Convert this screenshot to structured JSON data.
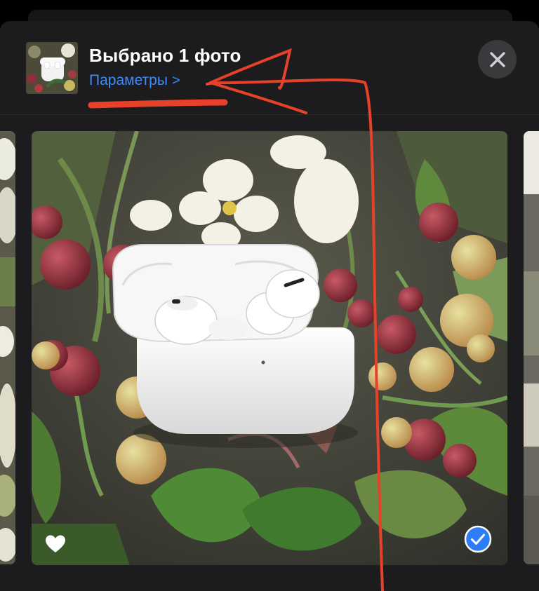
{
  "header": {
    "title": "Выбрано 1 фото",
    "options_label": "Параметры",
    "options_chevron": ">",
    "close_icon": "close-x-icon"
  },
  "carousel": {
    "current_photo": "airpods-pro-in-flowers",
    "favorite_icon": "heart-icon",
    "selected": true,
    "selected_icon": "checkmark-circle-icon"
  },
  "colors": {
    "accent": "#3d8bff",
    "annotation": "#e8412a",
    "sheet_background": "#1c1c1e"
  }
}
